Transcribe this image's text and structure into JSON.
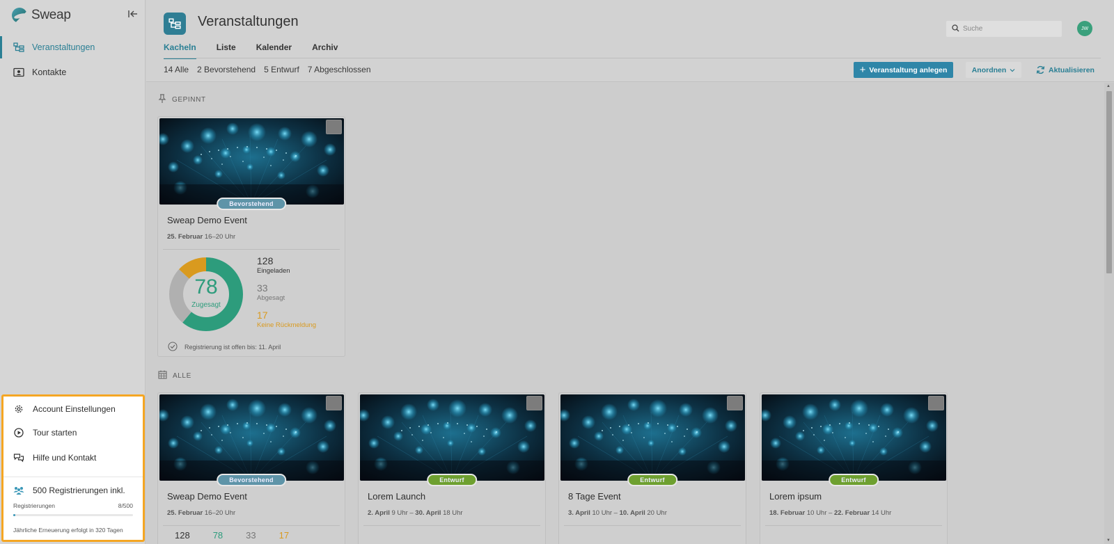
{
  "app": {
    "name": "Sweap"
  },
  "sidebar": {
    "items": [
      {
        "label": "Veranstaltungen",
        "active": true
      },
      {
        "label": "Kontakte",
        "active": false
      }
    ],
    "bottom": {
      "account": "Account Einstellungen",
      "tour": "Tour starten",
      "help": "Hilfe und Kontakt",
      "registrations_title": "500 Registrierungen inkl.",
      "registrations_label": "Registrierungen",
      "registrations_count": "8/500",
      "registrations_fraction": 0.016,
      "renewal": "Jährliche Erneuerung erfolgt in 320 Tagen"
    }
  },
  "header": {
    "title": "Veranstaltungen",
    "search_placeholder": "Suche",
    "avatar_initials": "JW",
    "tabs": [
      "Kacheln",
      "Liste",
      "Kalender",
      "Archiv"
    ],
    "filters": [
      "14 Alle",
      "2 Bevorstehend",
      "5 Entwurf",
      "7 Abgeschlossen"
    ],
    "create_button": "Veranstaltung anlegen",
    "arrange_button": "Anordnen",
    "refresh_button": "Aktualisieren"
  },
  "sections": {
    "pinned": "GEPINNT",
    "all": "ALLE"
  },
  "pinned_card": {
    "status": "Bevorstehend",
    "title": "Sweap Demo Event",
    "date_bold": "25. Februar",
    "date_rest": "16–20 Uhr",
    "accepted": "78",
    "accepted_label": "Zugesagt",
    "invited": "128",
    "invited_label": "Eingeladen",
    "declined": "33",
    "declined_label": "Abgesagt",
    "no_response": "17",
    "no_response_label": "Keine Rückmeldung",
    "registration_text": "Registrierung ist offen bis:  11. April"
  },
  "cards": [
    {
      "status": "Bevorstehend",
      "type": "upcoming",
      "title": "Sweap Demo Event",
      "d1": "25. Februar",
      "t1": "16–20 Uhr",
      "d2": "",
      "t2": ""
    },
    {
      "status": "Entwurf",
      "type": "draft",
      "title": "Lorem Launch",
      "d1": "2. April",
      "t1": "9 Uhr –",
      "d2": "30. April",
      "t2": "18 Uhr"
    },
    {
      "status": "Entwurf",
      "type": "draft",
      "title": "8 Tage Event",
      "d1": "3. April",
      "t1": "10 Uhr –",
      "d2": "10. April",
      "t2": "20 Uhr"
    },
    {
      "status": "Entwurf",
      "type": "draft",
      "title": "Lorem ipsum",
      "d1": "18. Februar",
      "t1": "10 Uhr –",
      "d2": "22. Februar",
      "t2": "14 Uhr"
    }
  ],
  "first_card_mini_stats": [
    "128",
    "78",
    "33",
    "17"
  ],
  "colors": {
    "accent": "#2a7f94",
    "accepted": "#2d9c7c",
    "declined": "#b0b0b0",
    "no_response": "#d99a1f",
    "highlight": "#f5a623"
  }
}
